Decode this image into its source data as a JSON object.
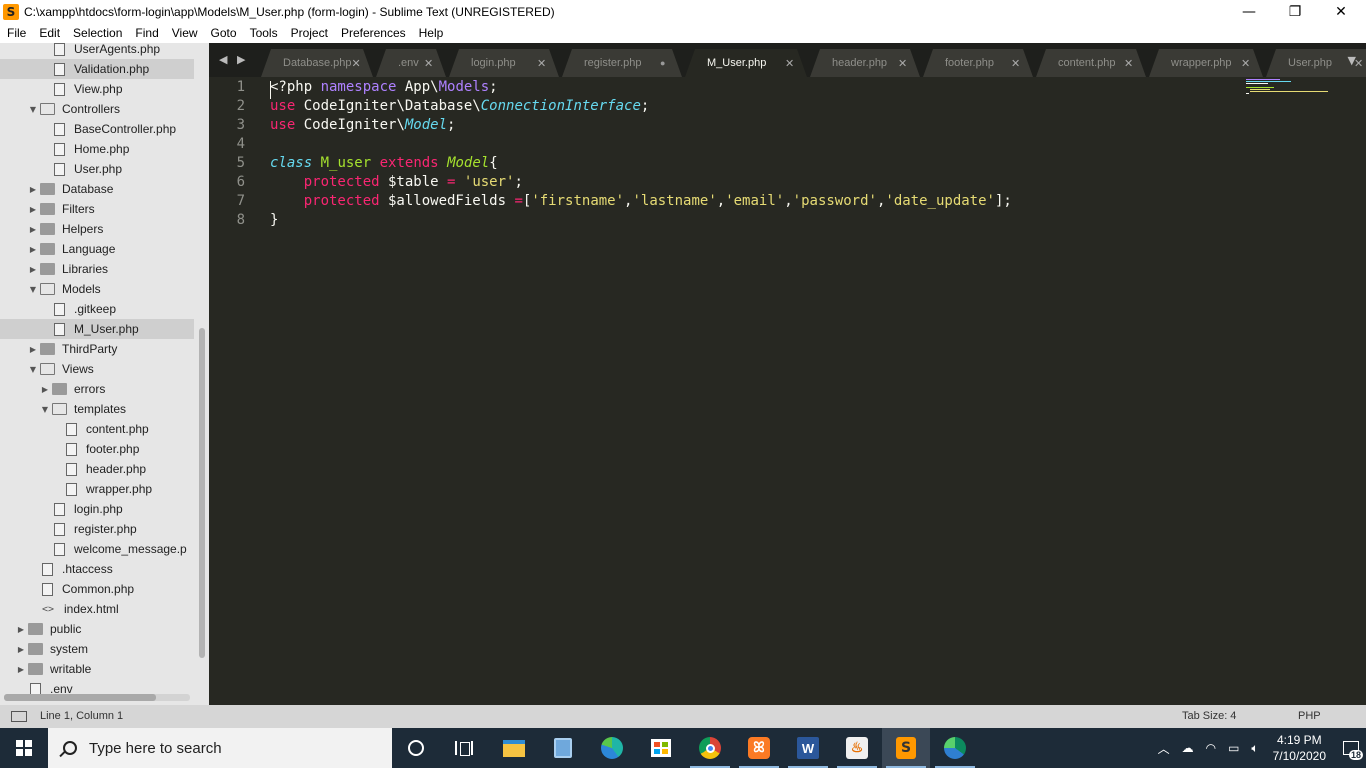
{
  "window": {
    "title": "C:\\xampp\\htdocs\\form-login\\app\\Models\\M_User.php (form-login) - Sublime Text (UNREGISTERED)",
    "app_icon_glyph": "S",
    "controls": {
      "minimize": "—",
      "restore": "❐",
      "close": "✕"
    }
  },
  "menu": [
    "File",
    "Edit",
    "Selection",
    "Find",
    "View",
    "Goto",
    "Tools",
    "Project",
    "Preferences",
    "Help"
  ],
  "sidebar": {
    "items": [
      {
        "label": "UserAgents.php",
        "type": "file",
        "depth": 2
      },
      {
        "label": "Validation.php",
        "type": "file",
        "depth": 2,
        "selected": true
      },
      {
        "label": "View.php",
        "type": "file",
        "depth": 2
      },
      {
        "label": "Controllers",
        "type": "folder-open",
        "depth": 1
      },
      {
        "label": "BaseController.php",
        "type": "file",
        "depth": 2
      },
      {
        "label": "Home.php",
        "type": "file",
        "depth": 2
      },
      {
        "label": "User.php",
        "type": "file",
        "depth": 2
      },
      {
        "label": "Database",
        "type": "folder",
        "depth": 1
      },
      {
        "label": "Filters",
        "type": "folder",
        "depth": 1
      },
      {
        "label": "Helpers",
        "type": "folder",
        "depth": 1
      },
      {
        "label": "Language",
        "type": "folder",
        "depth": 1
      },
      {
        "label": "Libraries",
        "type": "folder",
        "depth": 1
      },
      {
        "label": "Models",
        "type": "folder-open",
        "depth": 1
      },
      {
        "label": ".gitkeep",
        "type": "file",
        "depth": 2
      },
      {
        "label": "M_User.php",
        "type": "file",
        "depth": 2,
        "selected": true
      },
      {
        "label": "ThirdParty",
        "type": "folder",
        "depth": 1
      },
      {
        "label": "Views",
        "type": "folder-open",
        "depth": 1
      },
      {
        "label": "errors",
        "type": "folder",
        "depth": 2
      },
      {
        "label": "templates",
        "type": "folder-open",
        "depth": 2
      },
      {
        "label": "content.php",
        "type": "file",
        "depth": 3
      },
      {
        "label": "footer.php",
        "type": "file",
        "depth": 3
      },
      {
        "label": "header.php",
        "type": "file",
        "depth": 3
      },
      {
        "label": "wrapper.php",
        "type": "file",
        "depth": 3
      },
      {
        "label": "login.php",
        "type": "file",
        "depth": 2
      },
      {
        "label": "register.php",
        "type": "file",
        "depth": 2
      },
      {
        "label": "welcome_message.p",
        "type": "file",
        "depth": 2
      },
      {
        "label": ".htaccess",
        "type": "file",
        "depth": 1
      },
      {
        "label": "Common.php",
        "type": "file",
        "depth": 1
      },
      {
        "label": "index.html",
        "type": "code",
        "depth": 1
      },
      {
        "label": "public",
        "type": "folder",
        "depth": 0
      },
      {
        "label": "system",
        "type": "folder",
        "depth": 0
      },
      {
        "label": "writable",
        "type": "folder",
        "depth": 0
      },
      {
        "label": ".env",
        "type": "file",
        "depth": 0
      }
    ]
  },
  "tabs": {
    "nav_arrows": "◀ ▶",
    "overflow": "▼",
    "items": [
      {
        "label": "Database.php",
        "state": "normal"
      },
      {
        "label": ".env",
        "state": "normal"
      },
      {
        "label": "login.php",
        "state": "normal"
      },
      {
        "label": "register.php",
        "state": "dirty"
      },
      {
        "label": "M_User.php",
        "state": "active"
      },
      {
        "label": "header.php",
        "state": "normal"
      },
      {
        "label": "footer.php",
        "state": "normal"
      },
      {
        "label": "content.php",
        "state": "normal"
      },
      {
        "label": "wrapper.php",
        "state": "normal"
      },
      {
        "label": "User.php",
        "state": "normal"
      }
    ]
  },
  "editor": {
    "line_numbers": [
      "1",
      "2",
      "3",
      "4",
      "5",
      "6",
      "7",
      "8"
    ],
    "lines": [
      [
        [
          "<?php ",
          "plain"
        ],
        [
          "namespace",
          "ns"
        ],
        [
          " App\\",
          "plain"
        ],
        [
          "Models",
          "ns"
        ],
        [
          ";",
          "plain"
        ]
      ],
      [
        [
          "use",
          "kw"
        ],
        [
          " CodeIgniter\\Database\\",
          "plain"
        ],
        [
          "ConnectionInterface",
          "ital-blue"
        ],
        [
          ";",
          "plain"
        ]
      ],
      [
        [
          "use",
          "kw"
        ],
        [
          " CodeIgniter\\",
          "plain"
        ],
        [
          "Model",
          "ital-blue"
        ],
        [
          ";",
          "plain"
        ]
      ],
      [],
      [
        [
          "class",
          "st"
        ],
        [
          " ",
          "plain"
        ],
        [
          "M_user",
          "cls"
        ],
        [
          " ",
          "plain"
        ],
        [
          "extends",
          "kw"
        ],
        [
          " ",
          "plain"
        ],
        [
          "Model",
          "ital-green"
        ],
        [
          "{",
          "plain"
        ]
      ],
      [
        [
          "    ",
          "plain"
        ],
        [
          "protected",
          "kw"
        ],
        [
          " $table ",
          "plain"
        ],
        [
          "=",
          "kw"
        ],
        [
          " ",
          "plain"
        ],
        [
          "'user'",
          "str"
        ],
        [
          ";",
          "plain"
        ]
      ],
      [
        [
          "    ",
          "plain"
        ],
        [
          "protected",
          "kw"
        ],
        [
          " $allowedFields ",
          "plain"
        ],
        [
          "=",
          "kw"
        ],
        [
          "[",
          "plain"
        ],
        [
          "'firstname'",
          "str"
        ],
        [
          ",",
          "plain"
        ],
        [
          "'lastname'",
          "str"
        ],
        [
          ",",
          "plain"
        ],
        [
          "'email'",
          "str"
        ],
        [
          ",",
          "plain"
        ],
        [
          "'password'",
          "str"
        ],
        [
          ",",
          "plain"
        ],
        [
          "'date_update'",
          "str"
        ],
        [
          "];",
          "plain"
        ]
      ],
      [
        [
          "}",
          "plain"
        ]
      ]
    ]
  },
  "status": {
    "position": "Line 1, Column 1",
    "tab_size": "Tab Size: 4",
    "syntax": "PHP"
  },
  "taskbar": {
    "search_placeholder": "Type here to search",
    "time": "4:19 PM",
    "date": "7/10/2020",
    "notification_count": "18",
    "tray_icons": [
      "chevron-up-icon",
      "cloud-icon",
      "wifi-icon",
      "battery-icon",
      "volume-icon"
    ]
  },
  "colors": {
    "editor_bg": "#272822",
    "sidebar_bg": "#e6e6e6",
    "keyword": "#f92672",
    "string": "#e6db74",
    "type_italic": "#66d9ef",
    "class_name": "#a6e22e",
    "namespace": "#ae81ff",
    "taskbar_bg": "#1d2b38"
  }
}
